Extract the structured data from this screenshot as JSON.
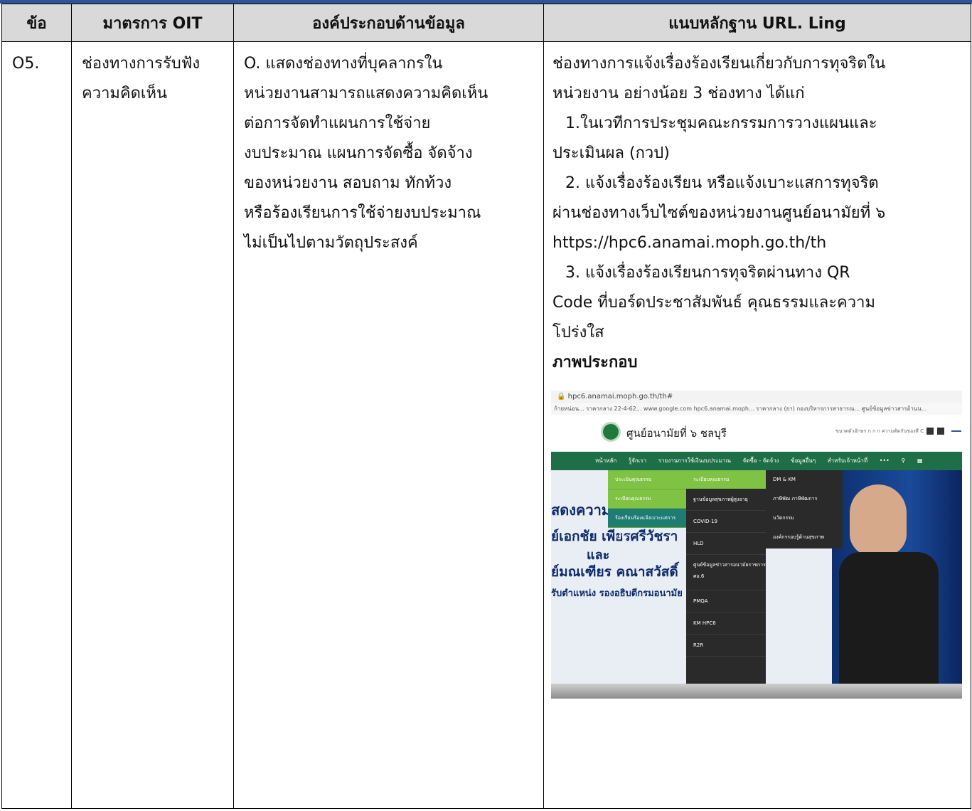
{
  "table": {
    "headers": [
      "ข้อ",
      "มาตรการ OIT",
      "องค์ประกอบด้านข้อมูล",
      "แนบหลักฐาน URL. Ling"
    ],
    "row": {
      "number": "O5.",
      "measure_lines": [
        "ช่องทางการรับฟัง",
        "ความคิดเห็น"
      ],
      "component_lines": [
        "O. แสดงช่องทางที่บุคลากรใน",
        "หน่วยงานสามารถแสดงความคิดเห็น",
        "ต่อการจัดทำแผนการใช้จ่าย",
        "งบประมาณ แผนการจัดซื้อ จัดจ้าง",
        "ของหน่วยงาน สอบถาม ทักท้วง",
        "หรือร้องเรียนการใช้จ่ายงบประมาณ",
        "ไม่เป็นไปตามวัตถุประสงค์"
      ],
      "evidence_lines": [
        "ช่องทางการแจ้งเรื่องร้องเรียนเกี่ยวกับการทุจริตใน",
        "หน่วยงาน อย่างน้อย 3 ช่องทาง ได้แก่",
        "1.ในเวทีการประชุมคณะกรรมการวางแผนและ",
        "ประเมินผล (กวป)",
        "2. แจ้งเรื่องร้องเรียน หรือแจ้งเบาะแสการทุจริต",
        "ผ่านช่องทางเว็บไซต์ของหน่วยงานศูนย์อนามัยที่ ๖",
        "https://hpc6.anamai.moph.go.th/th",
        "3. แจ้งเรื่องร้องเรียนการทุจริตผ่านทาง QR",
        "Code ที่บอร์ดประชาสัมพันธ์ คุณธรรมและความ",
        "โปร่งใส"
      ],
      "figure_heading": "ภาพประกอบ"
    }
  },
  "screenshot": {
    "url": "hpc6.anamai.moph.go.th/th#",
    "bookmarks": "ก้ายหน่อน...  ราคากลาง 22-4-62...  www.google.com  hpc6.anamai.moph...  ราคากลาง (ยา)  กองบริหารการสาธารณ...  ศูนย์ข้อมูลข่าวสารอ้านน...",
    "site_name": "ศูนย์อนามัยที่ ๖ ชลบุรี",
    "header_tools": "ขนาดตัวอักษร  ก  ก  ก   ความตัดกันของสี  C",
    "nav_items": [
      "หน้าหลัก",
      "รู้จักเรา",
      "รายงานการใช้เงินงบประมาณ",
      "จัดซื้อ - จัดจ้าง",
      "ข้อมูลอื่นๆ",
      "สำหรับเจ้าหน้าที่",
      "•••"
    ],
    "menu1": [
      "ประเมินคุณธรรม",
      "ระเบียบคุณธรรม",
      "ร้องเรียนร้องแจ้งเบาะแสการทุจริต"
    ],
    "menu2_active": "ระเบียบคุณธรรม",
    "menu2": [
      "ฐานข้อมูลสุขภาพผู้สูงอายุ",
      "COVID-19",
      "HLD",
      "ศูนย์ข้อมูลข่าวสารอนามัยราชการ ศอ.6",
      "PMQA",
      "KM HPC6",
      "R2R"
    ],
    "menu3": [
      "DM & KM",
      "ภาษีพัฒ ภาษีพัฒการ",
      "นวัตกรรม",
      "องค์กรรอบรู้ด้านสุขภาพ"
    ],
    "hero_lines": [
      "สดงความยิ",
      "ย์เอกชัย เพียรศรีวัชรา",
      "และ",
      "ย์มณเฑียร คณาสวัสดิ์",
      "รับตำแหน่ง รองอธิบดีกรมอนามัย"
    ]
  }
}
